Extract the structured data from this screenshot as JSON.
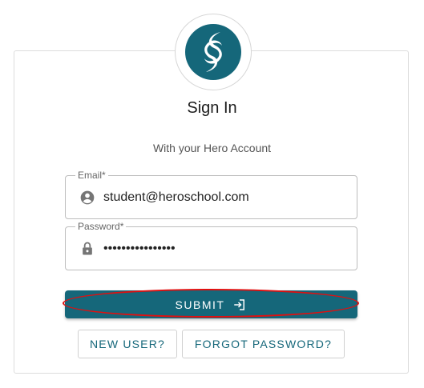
{
  "header": {
    "logo_icon": "hero-wave-logo-icon",
    "title": "Sign In",
    "subtitle": "With your Hero Account"
  },
  "form": {
    "email": {
      "label": "Email*",
      "value": "student@heroschool.com",
      "icon": "account-circle-icon"
    },
    "password": {
      "label": "Password*",
      "value": "studentpassword1",
      "icon": "lock-icon"
    }
  },
  "actions": {
    "submit_label": "SUBMIT",
    "submit_icon": "login-icon",
    "new_user_label": "NEW USER?",
    "forgot_password_label": "FORGOT PASSWORD?"
  },
  "colors": {
    "brand": "#15677a",
    "highlight": "#e01010"
  }
}
